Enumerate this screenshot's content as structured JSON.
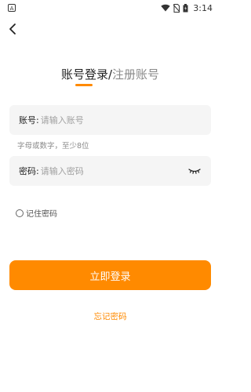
{
  "status_bar": {
    "app_badge": "A",
    "time": "3:14"
  },
  "header": {
    "login_tab": "账号登录",
    "separator": "/",
    "register_tab": "注册账号",
    "accent": "#ff8a00"
  },
  "account": {
    "label": "账号:",
    "placeholder": "请输入账号",
    "value": "",
    "hint": "字母或数字，至少8位"
  },
  "password": {
    "label": "密码:",
    "placeholder": "请输入密码",
    "value": "",
    "toggle_icon": "eye-closed-icon"
  },
  "remember": {
    "label": "记住密码",
    "checked": false
  },
  "actions": {
    "login_label": "立即登录",
    "forgot_label": "忘记密码"
  }
}
